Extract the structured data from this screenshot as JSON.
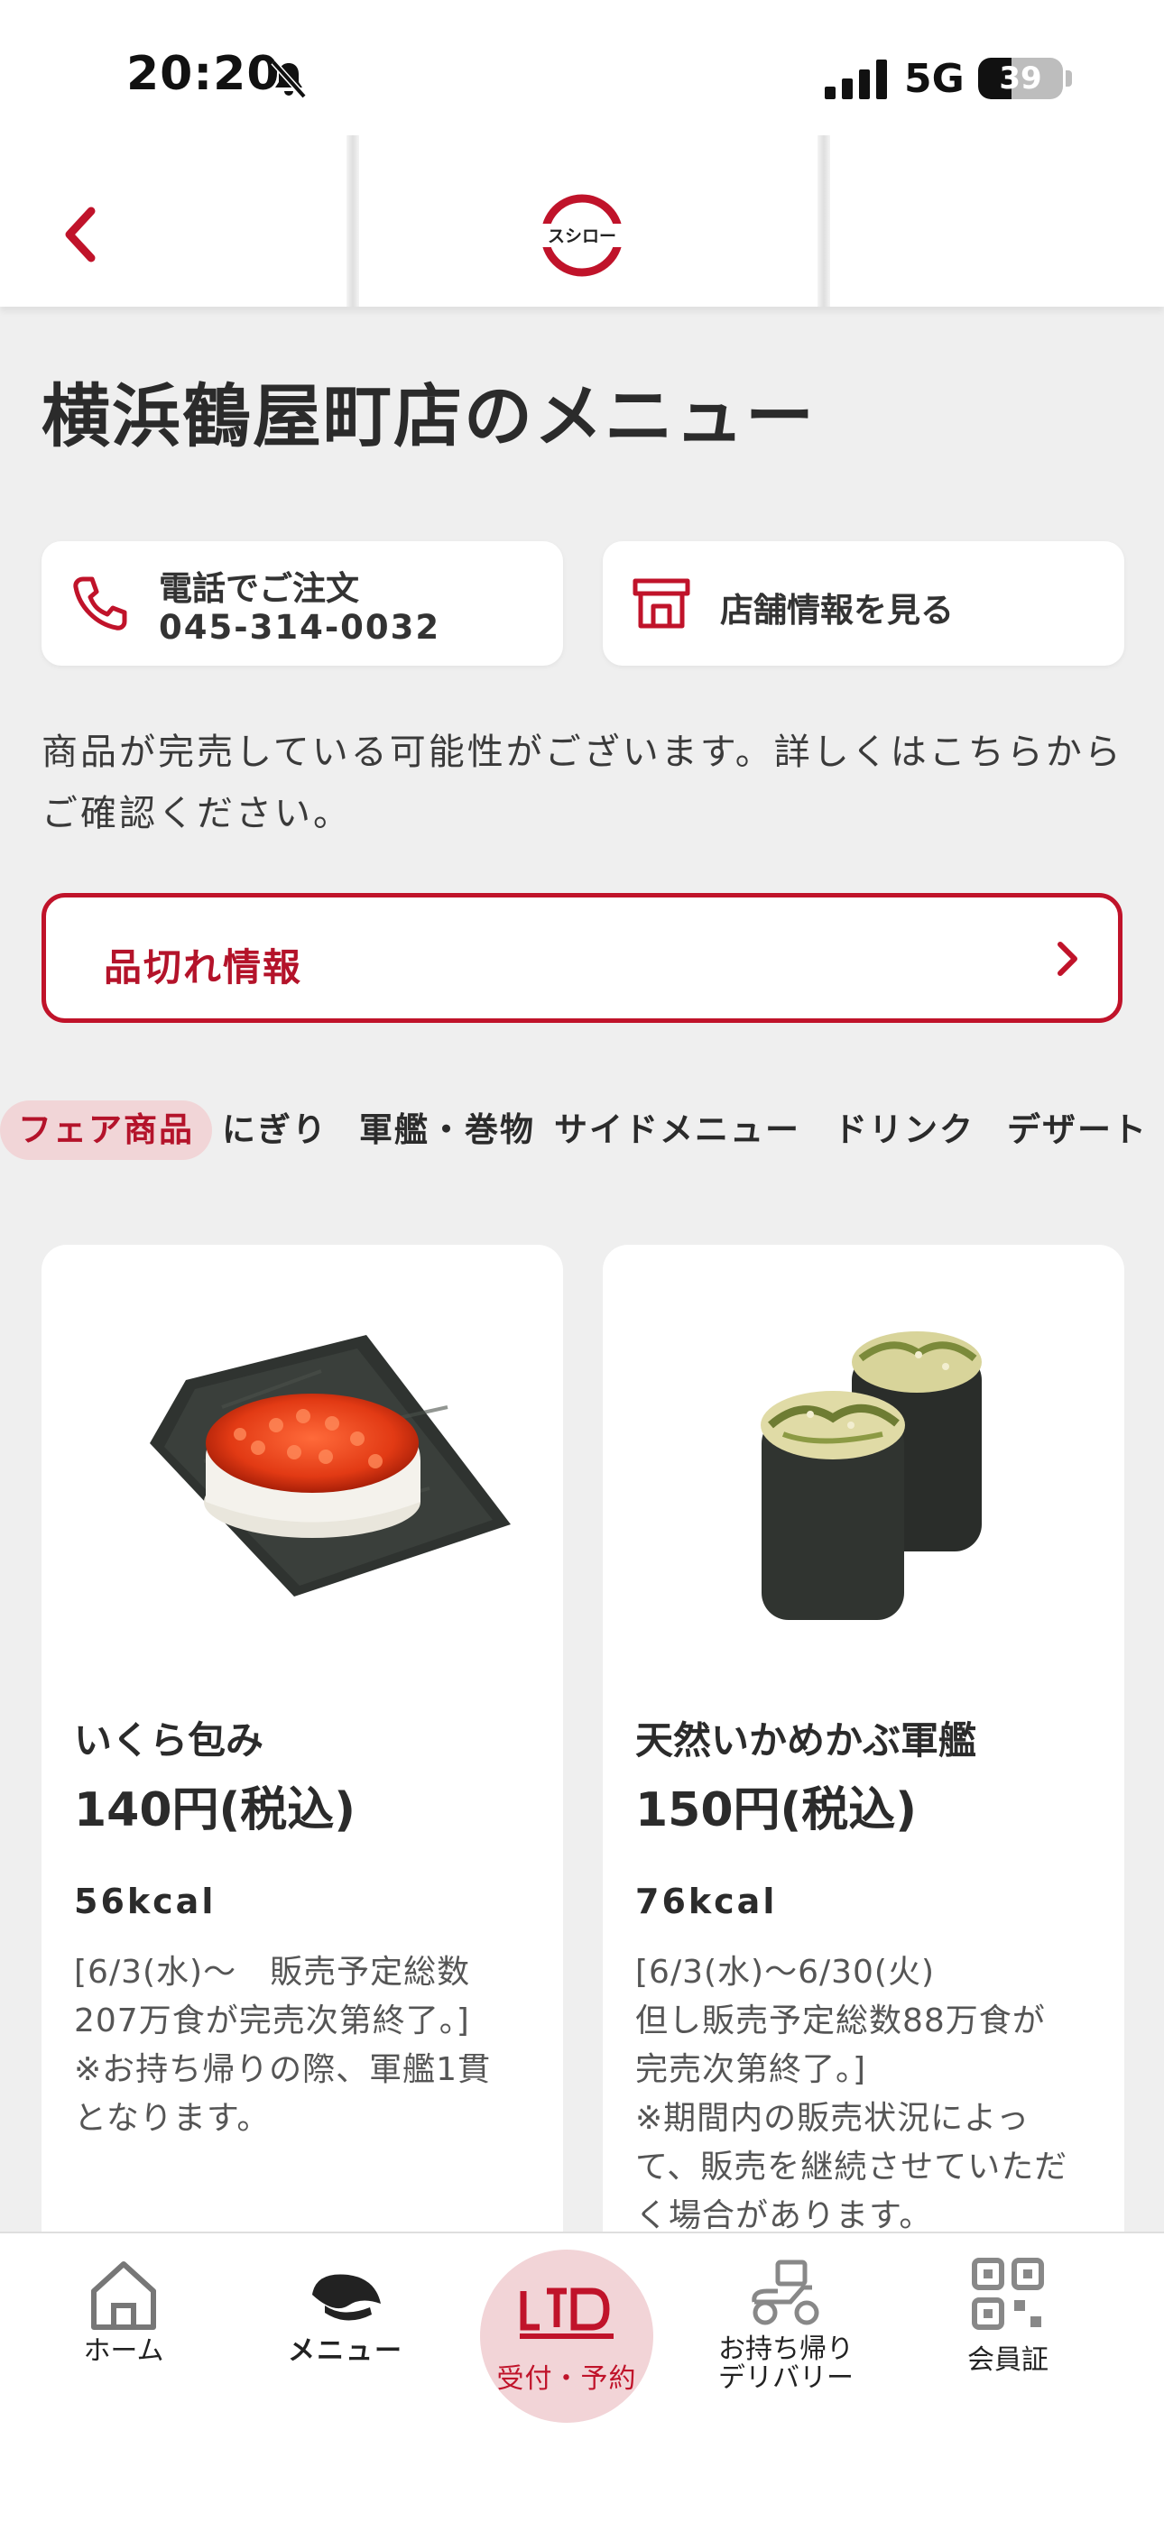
{
  "status_bar": {
    "time": "20:20",
    "network": "5G",
    "battery": "39",
    "battery_level": 0.39
  },
  "header": {
    "logo_text": "スシロー",
    "back_icon": "chevron-left-icon"
  },
  "page": {
    "title": "横浜鶴屋町店のメニュー"
  },
  "actions": {
    "phone_label": "電話でご注文",
    "phone_number": "045-314-0032",
    "store_label": "店舗情報を見る"
  },
  "notice": {
    "text": "商品が完売している可能性がございます。詳しくはこちらからご確認ください。"
  },
  "soldout": {
    "label": "品切れ情報"
  },
  "categories": [
    {
      "label": "フェア商品",
      "active": true
    },
    {
      "label": "にぎり",
      "active": false
    },
    {
      "label": "軍艦・巻物",
      "active": false
    },
    {
      "label": "サイドメニュー",
      "active": false
    },
    {
      "label": "ドリンク",
      "active": false
    },
    {
      "label": "デザート",
      "active": false
    }
  ],
  "products": [
    {
      "name": "いくら包み",
      "price": "140円(税込)",
      "kcal": "56kcal",
      "description": "[6/3(水)〜　販売予定総数\n207万食が完売次第終了。]\n※お持ち帰りの際、軍艦1貫\nとなります。"
    },
    {
      "name": "天然いかめかぶ軍艦",
      "price": "150円(税込)",
      "kcal": "76kcal",
      "description": "[6/3(水)〜6/30(火)\n但し販売予定総数88万食が\n完売次第終了。]\n※期間内の販売状況によっ\nて、販売を継続させていただ\nく場合があります。"
    }
  ],
  "bottom_nav": {
    "home": "ホーム",
    "menu": "メニュー",
    "reserve": "受付・予約",
    "takeout_line1": "お持ち帰り",
    "takeout_line2": "デリバリー",
    "member": "会員証"
  },
  "colors": {
    "brand_red": "#c0132a",
    "background": "#efefef",
    "active_tab_bg": "#f1d5d7"
  }
}
